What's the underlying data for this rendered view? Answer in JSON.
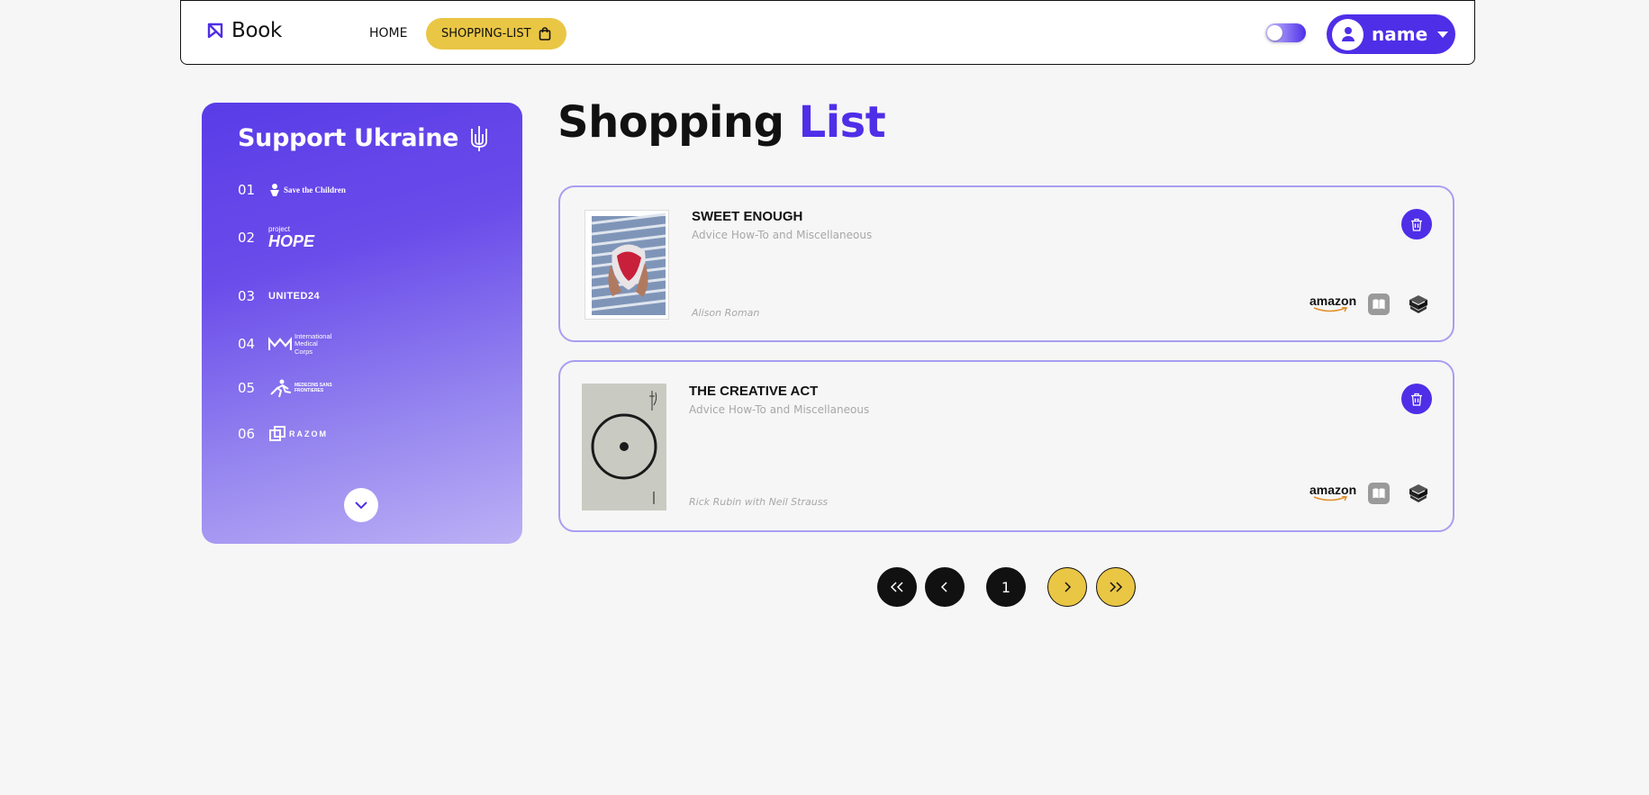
{
  "header": {
    "logo_text": "Book",
    "nav_home": "HOME",
    "nav_shopping": "SHOPPING-LIST",
    "user_name": "name"
  },
  "sidebar": {
    "title": "Support Ukraine",
    "funds": [
      {
        "num": "01",
        "name": "Save the Children"
      },
      {
        "num": "02",
        "name": "HOPE",
        "small": "project"
      },
      {
        "num": "03",
        "name": "UNITED24"
      },
      {
        "num": "04",
        "name": "International Medical Corps"
      },
      {
        "num": "05",
        "name": "MEDECINS SANS FRONTIERES"
      },
      {
        "num": "06",
        "name": "RAZOM"
      }
    ]
  },
  "main": {
    "title_part1": "Shopping",
    "title_part2": "List",
    "books": [
      {
        "title": "SWEET ENOUGH",
        "category": "Advice How-To and Miscellaneous",
        "author": "Alison Roman",
        "shops": [
          "amazon",
          "apple-books-icon",
          "bookshop-icon"
        ]
      },
      {
        "title": "THE CREATIVE ACT",
        "category": "Advice How-To and Miscellaneous",
        "author": "Rick Rubin with Neil Strauss",
        "shops": [
          "amazon",
          "apple-books-icon",
          "bookshop-icon"
        ]
      }
    ],
    "amazon_label": "amazon"
  },
  "pagination": {
    "current_page": "1"
  },
  "colors": {
    "accent": "#4f2ee8",
    "yellow": "#eac645",
    "background": "#f6f6f6"
  }
}
